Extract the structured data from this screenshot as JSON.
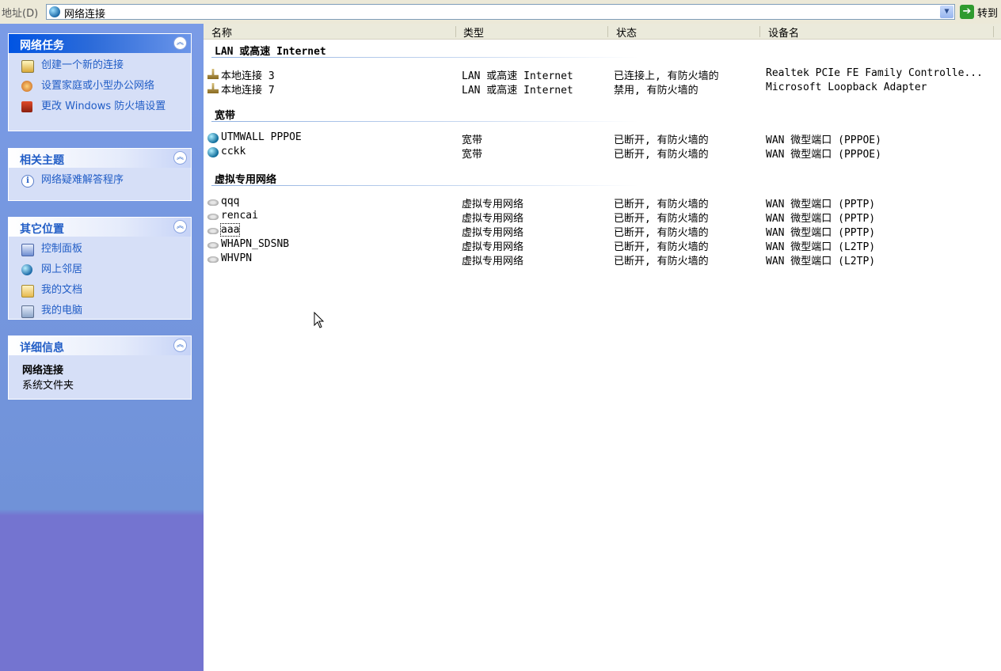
{
  "address": {
    "label": "地址(D)",
    "value": "网络连接",
    "go_label": "转到"
  },
  "sidebar": {
    "network_tasks": {
      "title": "网络任务",
      "items": [
        {
          "label": "创建一个新的连接",
          "icon": "new-connection-icon"
        },
        {
          "label": "设置家庭或小型办公网络",
          "icon": "home-network-icon"
        },
        {
          "label": "更改 Windows 防火墙设置",
          "icon": "firewall-icon"
        }
      ]
    },
    "related": {
      "title": "相关主题",
      "items": [
        {
          "label": "网络疑难解答程序",
          "icon": "info-icon"
        }
      ]
    },
    "other_places": {
      "title": "其它位置",
      "items": [
        {
          "label": "控制面板",
          "icon": "control-panel-icon"
        },
        {
          "label": "网上邻居",
          "icon": "network-places-icon"
        },
        {
          "label": "我的文档",
          "icon": "my-documents-icon"
        },
        {
          "label": "我的电脑",
          "icon": "my-computer-icon"
        }
      ]
    },
    "details": {
      "title": "详细信息",
      "name": "网络连接",
      "type": "系统文件夹"
    }
  },
  "columns": [
    "名称",
    "类型",
    "状态",
    "设备名"
  ],
  "groups": [
    {
      "title": "LAN 或高速 Internet",
      "rows": [
        {
          "name": "本地连接 3",
          "type": "LAN 或高速 Internet",
          "status": "已连接上, 有防火墙的",
          "device": "Realtek PCIe FE Family Controlle...",
          "icon": "lan-icon"
        },
        {
          "name": "本地连接 7",
          "type": "LAN 或高速 Internet",
          "status": "禁用, 有防火墙的",
          "device": "Microsoft Loopback Adapter",
          "icon": "lan-icon"
        }
      ]
    },
    {
      "title": "宽带",
      "rows": [
        {
          "name": "UTMWALL PPPOE",
          "type": "宽带",
          "status": "已断开, 有防火墙的",
          "device": "WAN 微型端口 (PPPOE)",
          "icon": "broadband-icon"
        },
        {
          "name": "cckk",
          "type": "宽带",
          "status": "已断开, 有防火墙的",
          "device": "WAN 微型端口 (PPPOE)",
          "icon": "broadband-icon"
        }
      ]
    },
    {
      "title": "虚拟专用网络",
      "rows": [
        {
          "name": "qqq",
          "type": "虚拟专用网络",
          "status": "已断开, 有防火墙的",
          "device": "WAN 微型端口 (PPTP)",
          "icon": "vpn-icon"
        },
        {
          "name": "rencai",
          "type": "虚拟专用网络",
          "status": "已断开, 有防火墙的",
          "device": "WAN 微型端口 (PPTP)",
          "icon": "vpn-icon"
        },
        {
          "name": "aaa",
          "type": "虚拟专用网络",
          "status": "已断开, 有防火墙的",
          "device": "WAN 微型端口 (PPTP)",
          "icon": "vpn-icon"
        },
        {
          "name": "WHAPN_SDSNB",
          "type": "虚拟专用网络",
          "status": "已断开, 有防火墙的",
          "device": "WAN 微型端口 (L2TP)",
          "icon": "vpn-icon"
        },
        {
          "name": "WHVPN",
          "type": "虚拟专用网络",
          "status": "已断开, 有防火墙的",
          "device": "WAN 微型端口 (L2TP)",
          "icon": "vpn-icon"
        }
      ]
    }
  ],
  "colors": {
    "sidebar_top": "#7a9be6",
    "sidebar_bottom": "#7474d0",
    "panel_bg": "#d6dff7",
    "link": "#215dc6",
    "special_header": "#0054e3"
  }
}
